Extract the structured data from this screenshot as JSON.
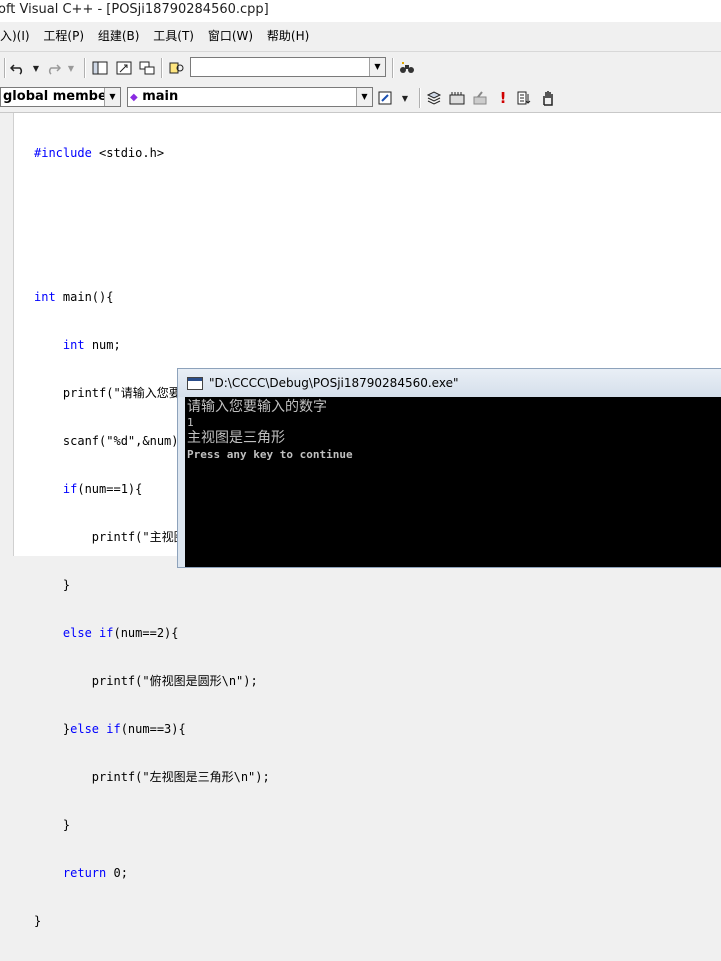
{
  "window": {
    "title": "oft Visual C++ - [POSji18790284560.cpp]"
  },
  "menu": [
    {
      "label": "入)(I)"
    },
    {
      "label": "工程(P)"
    },
    {
      "label": "组建(B)"
    },
    {
      "label": "工具(T)"
    },
    {
      "label": "窗口(W)"
    },
    {
      "label": "帮助(H)"
    }
  ],
  "toolbar": {
    "undo_icon": "undo-icon",
    "redo_icon": "redo-icon",
    "find_combo_value": ""
  },
  "wizardbar": {
    "class_combo": "global members",
    "member_combo": "main"
  },
  "editor": {
    "lines": [
      "#include <stdio.h>",
      "",
      "",
      "int main(){",
      "    int num;",
      "    printf(\"请输入您要输入的数字\\n\");",
      "    scanf(\"%d\",&num);",
      "    if(num==1){",
      "        printf(\"主视图是三角形\\n\");",
      "    }",
      "    else if(num==2){",
      "        printf(\"俯视图是圆形\\n\");",
      "    }else if(num==3){",
      "        printf(\"左视图是三角形\\n\");",
      "    }",
      "    return 0;",
      "}"
    ]
  },
  "console": {
    "title": "\"D:\\CCCC\\Debug\\POSji18790284560.exe\"",
    "lines": [
      "请输入您要输入的数字",
      "1",
      "主视图是三角形",
      "Press any key to continue"
    ]
  }
}
